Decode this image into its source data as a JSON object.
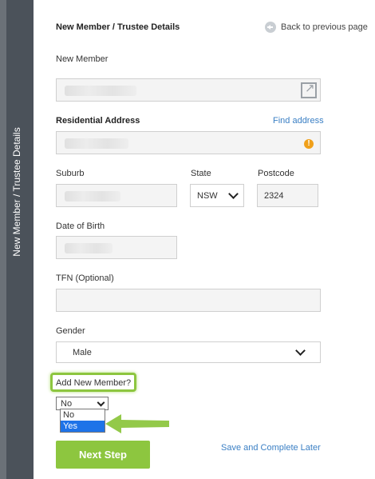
{
  "sidebar": {
    "title": "New Member / Trustee Details"
  },
  "header": {
    "title": "New Member / Trustee Details",
    "back_label": "Back to previous page"
  },
  "form": {
    "new_member_label": "New Member",
    "residential_label": "Residential Address",
    "find_address_label": "Find address",
    "suburb_label": "Suburb",
    "state_label": "State",
    "state_value": "NSW",
    "postcode_label": "Postcode",
    "postcode_value": "2324",
    "dob_label": "Date of Birth",
    "tfn_label": "TFN (Optional)",
    "tfn_value": "",
    "gender_label": "Gender",
    "gender_value": "Male",
    "add_member_label": "Add New Member?",
    "add_member_value": "No",
    "add_member_options": [
      "No",
      "Yes"
    ],
    "add_member_highlighted": "Yes"
  },
  "actions": {
    "next_label": "Next Step",
    "save_later_label": "Save and Complete Later"
  },
  "colors": {
    "sidebar": "#4b525a",
    "accent_green": "#8dc63f",
    "link_blue": "#3a7fc4",
    "warning": "#f0a01a",
    "option_highlight": "#1e73e8"
  },
  "icons": [
    "back-arrow-icon",
    "external-link-icon",
    "warning-icon",
    "chevron-down-icon",
    "green-arrow-annotation"
  ]
}
